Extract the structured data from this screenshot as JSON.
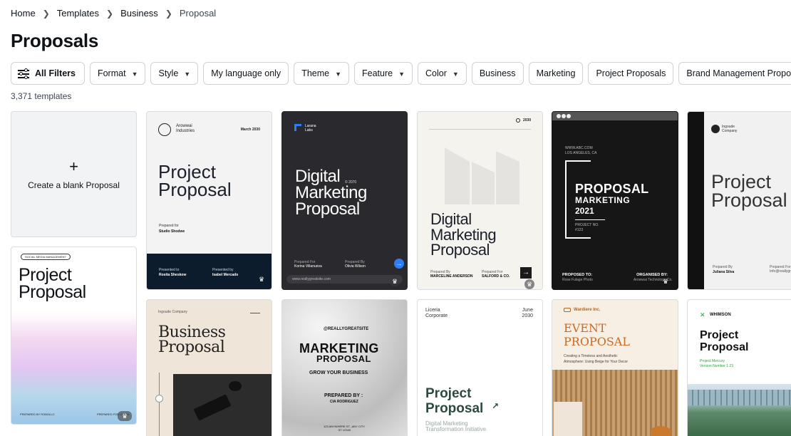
{
  "breadcrumb": [
    "Home",
    "Templates",
    "Business",
    "Proposal"
  ],
  "page_title": "Proposals",
  "filters": {
    "all_filters": "All Filters",
    "format": "Format",
    "style": "Style",
    "language": "My language only",
    "theme": "Theme",
    "feature": "Feature",
    "color": "Color",
    "business": "Business",
    "marketing": "Marketing",
    "project_proposals": "Project Proposals",
    "brand_management": "Brand Management Proposals"
  },
  "count": "3,371 templates",
  "blank": {
    "plus": "+",
    "label": "Create a blank Proposal"
  },
  "templates": {
    "t1": {
      "brand": "Arowwai\nIndustries",
      "date": "March 2030",
      "title": "Project\nProposal",
      "prepared": "Prepared for",
      "client": "Studio Shodwe",
      "f1": "Presented to",
      "f1v": "Rosita Sheskow",
      "f2": "Presented by",
      "f2v": "Isabel Mercado"
    },
    "t2": {
      "brand": "Larana\nLabs",
      "title": "Digital\nMarketing\nProposal",
      "year": "© 2070",
      "f1": "Prepared For",
      "f1v": "Korina Villanueva",
      "f2": "Prepared By",
      "f2v": "Olivia Wilson",
      "url": "www.reallygreatsite.com"
    },
    "t3": {
      "year": "2030",
      "title": "Digital\nMarketing\nProposal",
      "f1": "Prepared By",
      "f1v": "MARCELINE ANDERSON",
      "f2": "Prepared For",
      "f2v": "SALFORD & CO."
    },
    "t4": {
      "addr": "WWW.ABC.COM\nLOS ANGELES, CA",
      "title": "PROPOSAL",
      "sub": "MARKETING",
      "year": "2021",
      "proj": "PROJECT NO.\n#123",
      "to": "PROPOSED TO:",
      "tov": "Rose Fulage Photo",
      "by": "ORGANISED BY:",
      "byv": "Arowwai Technology Co."
    },
    "t5": {
      "brand": "Ingoude\nCompany",
      "title": "Project\nProposal",
      "prepared": "Prepared By",
      "name": "Juliana Silva",
      "right": "Prepared For\nInfo@reallygreatsite.com"
    },
    "t6": {
      "badge": "SOCIAL MEDIA MANAGEMENT",
      "title": "Project\nProposal",
      "f1": "PREPARED BY ROBOLLO",
      "f2": "PREPARED FOR OLIVIA"
    },
    "t7": {
      "brand": "Ingoude Company",
      "title": "Business\nProposal"
    },
    "t8": {
      "site": "@REALLYGREATSITE",
      "title": "MARKETING",
      "sub": "PROPOSAL",
      "tag": "GROW YOUR BUSINESS",
      "prep": "PREPARED BY :",
      "name": "CIA RODRIGUEZ",
      "addr": "123 ANYWHERE ST., ANY CITY,\nST 12345"
    },
    "t9": {
      "brand": "Liceria\nCorporate",
      "date": "June\n2030",
      "title": "Project\nProposal",
      "arrow": "↗",
      "sub": "Digital Marketing\nTransformation Initiative"
    },
    "t10": {
      "brand": "Wardiere Inc.",
      "title": "EVENT\nPROPOSAL",
      "sub": "Creating a Timeless and Aesthetic\nAtmosphere: Using Beige for Your Decor"
    },
    "t11": {
      "brand": "WHIMSON",
      "title": "Project\nProposal",
      "sub": "Project Mercury\nVersion Number 1.23"
    }
  },
  "colors": {
    "accent": "#8b3dff",
    "dark": "#1a1a1e",
    "navy": "#0c1c2c"
  },
  "icons": {
    "crown": "crown-icon",
    "next": "arrow-right-icon"
  }
}
